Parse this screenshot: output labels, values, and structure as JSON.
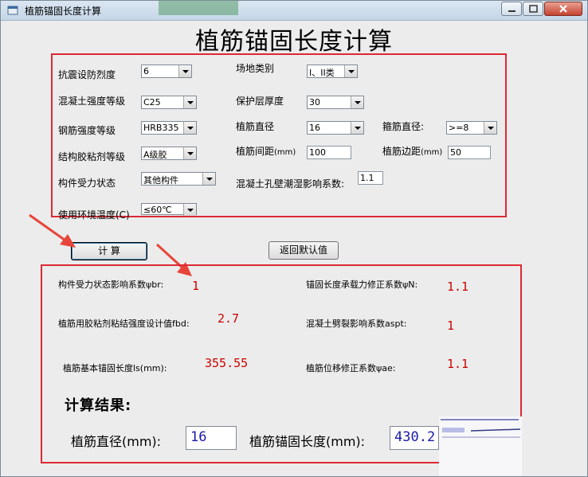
{
  "window": {
    "title": "植筋锚固长度计算",
    "controls": {
      "minimize": "minimize",
      "maximize": "maximize",
      "close": "close"
    }
  },
  "main_title": "植筋锚固长度计算",
  "inputs": {
    "seismic": {
      "label": "抗震设防烈度",
      "value": "6"
    },
    "site": {
      "label": "场地类别",
      "value": "I、II类"
    },
    "concrete": {
      "label": "混凝土强度等级",
      "value": "C25"
    },
    "cover": {
      "label": "保护层厚度",
      "value": "30"
    },
    "steel": {
      "label": "钢筋强度等级",
      "value": "HRB335"
    },
    "bar_dia": {
      "label": "植筋直径",
      "value": "16"
    },
    "stirrup": {
      "label": "箍筋直径:",
      "value": ">=8"
    },
    "adhesive": {
      "label": "结构胶粘剂等级",
      "value": "A级胶"
    },
    "spacing": {
      "label": "植筋间距",
      "unit": "(mm)",
      "value": "100"
    },
    "edge": {
      "label": "植筋边距",
      "unit": "(mm)",
      "value": "50"
    },
    "stress": {
      "label": "构件受力状态",
      "value": "其他构件"
    },
    "humidity": {
      "label": "混凝土孔壁潮湿影响系数:",
      "value": "1.1"
    },
    "env_temp": {
      "label": "使用环境温度(C)",
      "value": "≤60℃"
    }
  },
  "buttons": {
    "calc": "计    算",
    "reset": "返回默认值"
  },
  "coefficients": {
    "psi_br": {
      "label": "构件受力状态影响系数ψbr:",
      "value": "1"
    },
    "psi_n": {
      "label": "锚固长度承载力修正系数ψN:",
      "value": "1.1"
    },
    "fbd": {
      "label": "植筋用胶粘剂粘结强度设计值fbd:",
      "value": "2.7"
    },
    "aspt": {
      "label": "混凝土劈裂影响系数aspt:",
      "value": "1"
    },
    "ls": {
      "label": "植筋基本锚固长度ls(mm):",
      "value": "355.55"
    },
    "psi_ae": {
      "label": "植筋位移修正系数ψae:",
      "value": "1.1"
    }
  },
  "result": {
    "heading": "计算结果:",
    "dia_label": "植筋直径(mm):",
    "dia_value": "16",
    "len_label": "植筋锚固长度(mm):",
    "len_value": "430.2"
  },
  "colors": {
    "highlight_border": "#dc2a33",
    "value_red": "#cc0000",
    "result_blue": "#1a1aa8"
  }
}
